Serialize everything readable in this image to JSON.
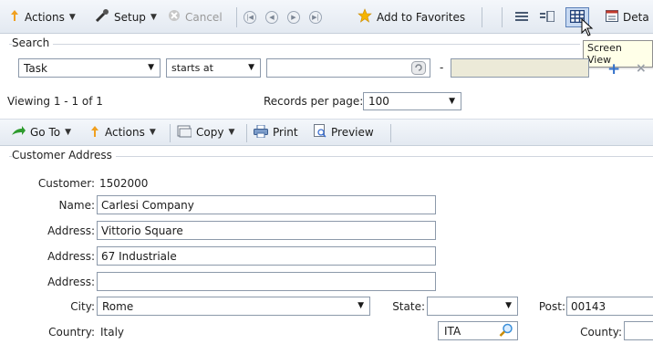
{
  "toolbar": {
    "actions_label": "Actions",
    "setup_label": "Setup",
    "cancel_label": "Cancel",
    "favorites_label": "Add to Favorites",
    "details_label": "Deta",
    "tooltip": "Screen View"
  },
  "search": {
    "group_title": "Search",
    "field_value": "Task",
    "operator_value": "starts at",
    "value_text": "",
    "range_separator": "-",
    "range_end": ""
  },
  "paging": {
    "viewing_text": "Viewing 1 - 1  of 1",
    "records_label": "Records per page:",
    "records_value": "100"
  },
  "toolbar2": {
    "goto_label": "Go To",
    "actions_label": "Actions",
    "copy_label": "Copy",
    "print_label": "Print",
    "preview_label": "Preview"
  },
  "form": {
    "group_title": "Customer Address",
    "customer_label": "Customer:",
    "customer_value": "1502000",
    "name_label": "Name:",
    "name_value": "Carlesi Company",
    "address_label": "Address:",
    "address1_value": "Vittorio Square",
    "address2_value": "67 Industriale",
    "address3_value": "",
    "city_label": "City:",
    "city_value": "Rome",
    "state_label": "State:",
    "state_value": "",
    "post_label": "Post:",
    "post_value": "00143",
    "country_label": "Country:",
    "country_value": "Italy",
    "country_code": "ITA",
    "county_label": "County:",
    "county_value": ""
  },
  "colors": {
    "accent": "#3b6fd1",
    "range_fill": "#ecead8",
    "add_blue": "#2f6fc9",
    "favorites_star": "#f5b400"
  }
}
